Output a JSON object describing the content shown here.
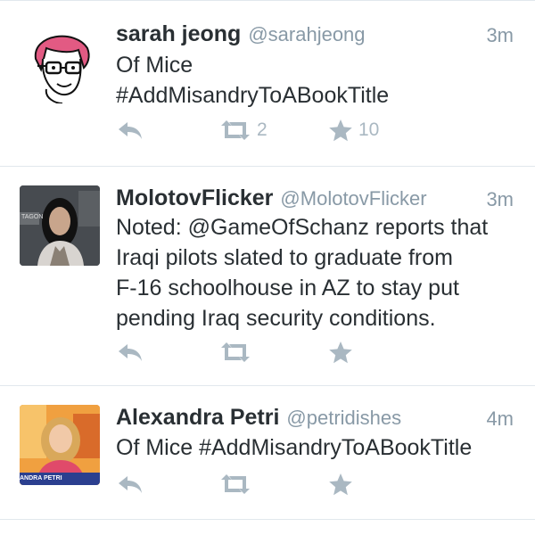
{
  "tweets": [
    {
      "name": "sarah jeong",
      "handle": "@sarahjeong",
      "time": "3m",
      "lines": [
        "Of Mice",
        "#AddMisandryToABookTitle"
      ],
      "retweets": "2",
      "favorites": "10"
    },
    {
      "name": "MolotovFlicker",
      "handle": "@MolotovFlicker",
      "time": "3m",
      "lines": [
        "Noted: @GameOfSchanz reports that",
        "Iraqi pilots slated to graduate from",
        "F-16 schoolhouse in AZ to stay put",
        "pending Iraq security conditions."
      ],
      "avatar_caption": "TAGON",
      "retweets": "",
      "favorites": ""
    },
    {
      "name": "Alexandra Petri",
      "handle": "@petridishes",
      "time": "4m",
      "lines": [
        "Of Mice #AddMisandryToABookTitle"
      ],
      "avatar_caption": "ANDRA PETRI",
      "retweets": "",
      "favorites": ""
    }
  ],
  "colors": {
    "text": "#292f33",
    "muted": "#8899a6",
    "icon": "#aab8c2",
    "divider": "#e1e8ed"
  }
}
